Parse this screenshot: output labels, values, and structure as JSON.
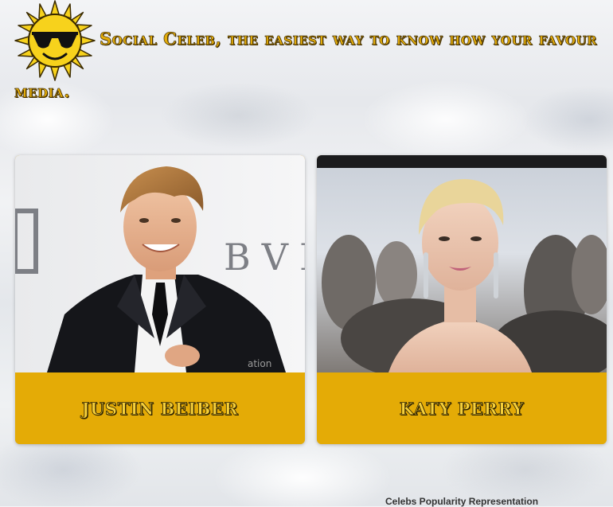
{
  "header": {
    "tagline_line1": "Social Celeb, the easiest way to know how your favour",
    "tagline_line2": "media."
  },
  "celebs": [
    {
      "name": "JUSTIN BEIBER"
    },
    {
      "name": "KATY PERRY"
    }
  ],
  "chart": {
    "heading": "Celebs Popularity Representation"
  },
  "colors": {
    "accent": "#e4ab06",
    "caption_text": "#f5cf3a",
    "logo_sun": "#f7d21c"
  },
  "icons": {
    "logo": "sun-with-sunglasses-icon"
  }
}
